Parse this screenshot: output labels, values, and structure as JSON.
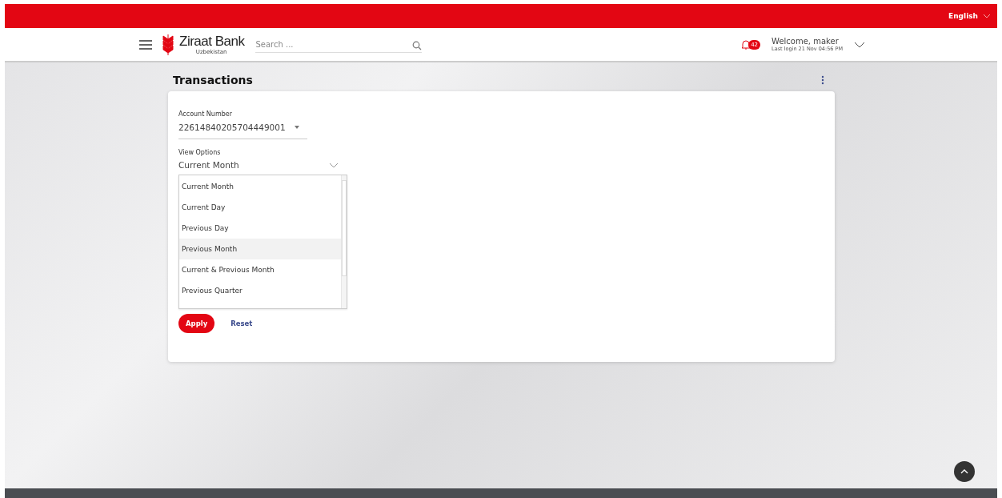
{
  "top_bar": {
    "language": "English"
  },
  "header": {
    "bank_name": "Ziraat Bank",
    "bank_region": "Uzbekistan",
    "search": {
      "placeholder": "Search ..."
    },
    "notifications": "42",
    "welcome": "Welcome, maker",
    "last_login": "Last login 21 Nov 04:56 PM"
  },
  "page_title": "Transactions",
  "form": {
    "account_label": "Account Number",
    "account_value": "22614840205704449001",
    "view_label": "View Options",
    "view_value": "Current Month",
    "options": [
      {
        "label": "Current Month",
        "selected": false
      },
      {
        "label": "Current Day",
        "selected": false
      },
      {
        "label": "Previous Day",
        "selected": false
      },
      {
        "label": "Previous Month",
        "selected": true
      },
      {
        "label": "Current & Previous Month",
        "selected": false
      },
      {
        "label": "Previous Quarter",
        "selected": false
      }
    ],
    "buttons": [
      {
        "label": "Apply",
        "kind": "primary"
      },
      {
        "label": "Reset",
        "kind": "link"
      }
    ]
  }
}
